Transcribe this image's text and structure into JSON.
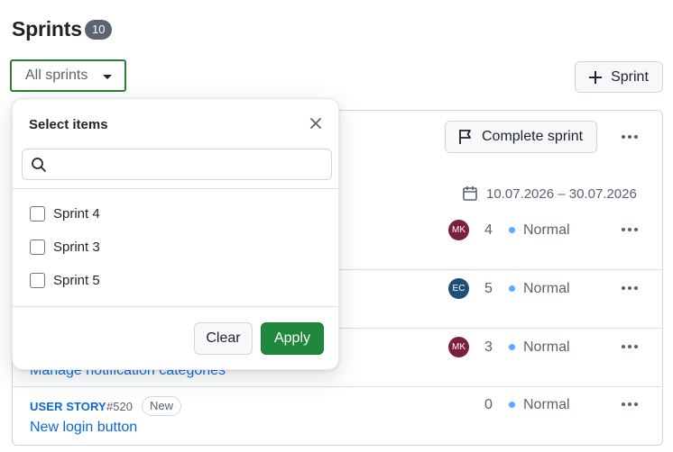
{
  "header": {
    "title": "Sprints",
    "count": "10",
    "filter_label": "All sprints",
    "add_sprint_label": "Sprint"
  },
  "sprint": {
    "complete_label": "Complete sprint",
    "date_range": "10.07.2026 – 30.07.2026"
  },
  "rows": [
    {
      "avatar": "MK",
      "avatar_color": "#7a1f3d",
      "count": "4",
      "priority": "Normal"
    },
    {
      "avatar": "EC",
      "avatar_color": "#1f4e79",
      "count": "5",
      "priority": "Normal"
    },
    {
      "avatar": "MK",
      "avatar_color": "#7a1f3d",
      "count": "3",
      "priority": "Normal",
      "title": "Manage notification categories"
    },
    {
      "type": "USER STORY",
      "id": "#520",
      "badge": "New",
      "count": "0",
      "priority": "Normal",
      "title": "New login button"
    }
  ],
  "popup": {
    "title": "Select items",
    "search_value": "",
    "items": [
      {
        "label": "Sprint 4",
        "checked": false
      },
      {
        "label": "Sprint 3",
        "checked": false
      },
      {
        "label": "Sprint 5",
        "checked": false
      }
    ],
    "clear_label": "Clear",
    "apply_label": "Apply"
  },
  "colors": {
    "accent_green": "#1f883d",
    "link_blue": "#0969da",
    "priority_dot": "#54aeff"
  }
}
